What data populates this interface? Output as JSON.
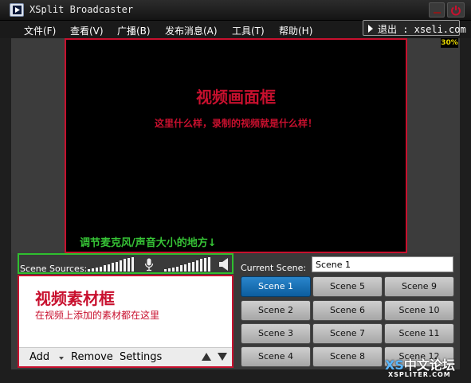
{
  "window": {
    "title": "XSplit Broadcaster"
  },
  "menu": {
    "items": [
      "文件(F)",
      "查看(V)",
      "广播(B)",
      "发布消息(A)",
      "工具(T)",
      "帮助(H)"
    ],
    "exit_label": "退出 : xseli.com"
  },
  "preview": {
    "zoom": "30%",
    "frame_title": "视频画面框",
    "frame_subtitle": "这里什么样，录制的视频就是什么样！",
    "mic_note": "调节麦克风/声音大小的地方↓"
  },
  "sources": {
    "label": "Scene Sources:",
    "title": "视频素材框",
    "description": "在视频上添加的素材都在这里",
    "toolbar": {
      "add": "Add",
      "remove": "Remove",
      "settings": "Settings"
    }
  },
  "scenes": {
    "current_label": "Current Scene:",
    "current_value": "Scene 1",
    "buttons": [
      "Scene 1",
      "Scene 2",
      "Scene 3",
      "Scene 4",
      "Scene 5",
      "Scene 6",
      "Scene 7",
      "Scene 8",
      "Scene 9",
      "Scene 10",
      "Scene 11",
      "Scene 12"
    ],
    "active_index": 0
  },
  "watermark": {
    "main_prefix": "XS",
    "main_rest": "中文论坛",
    "url": "XSPLITER.COM"
  },
  "colors": {
    "annotation_red": "#c8102e",
    "annotation_green": "#2fbf2f",
    "active_scene": "#0c5d9e",
    "zoom_text": "#e8d800"
  }
}
